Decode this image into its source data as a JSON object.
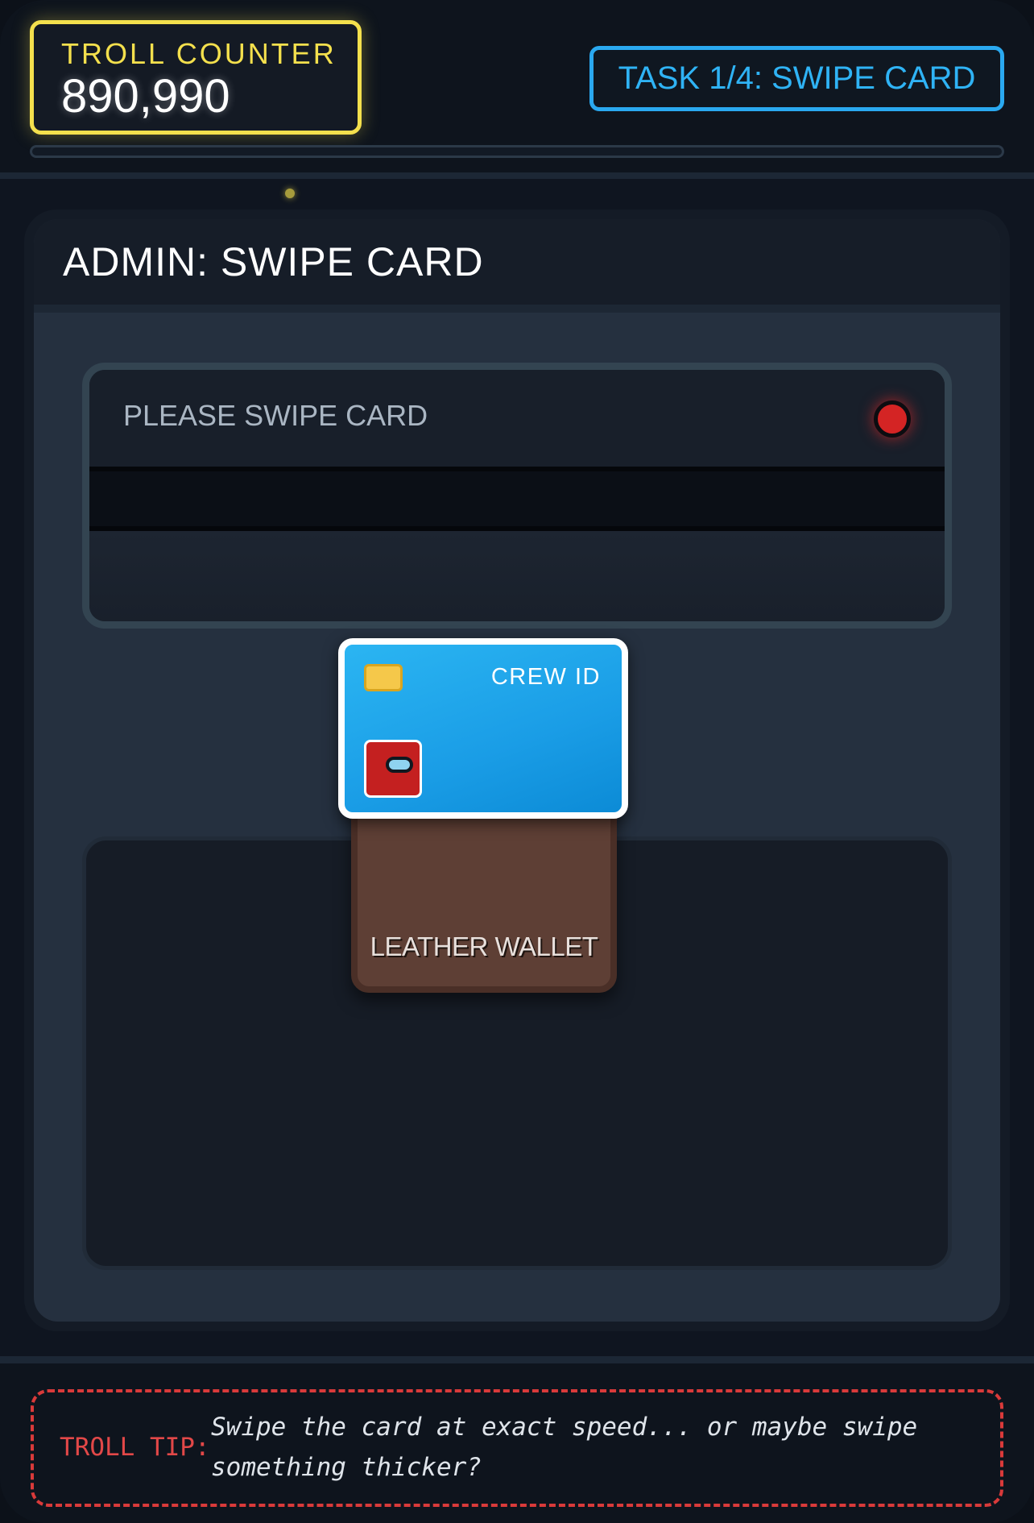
{
  "header": {
    "troll_counter_label": "TROLL COUNTER",
    "troll_counter_value": "890,990",
    "task_badge": "TASK 1/4: SWIPE CARD",
    "progress": 0
  },
  "panel": {
    "title": "ADMIN: SWIPE CARD",
    "reader": {
      "status": "PLEASE SWIPE CARD",
      "led_color": "#d42424"
    },
    "card": {
      "label": "CREW ID",
      "color": "#1a9de6",
      "chip_icon": "card-chip-icon",
      "avatar_icon": "crewmate-icon"
    },
    "wallet": {
      "label": "LEATHER WALLET"
    }
  },
  "footer": {
    "tip_label": "TROLL TIP:",
    "tip_text": "Swipe the card at exact speed... or maybe swipe something thicker?"
  },
  "colors": {
    "accent_yellow": "#f4e04d",
    "accent_blue": "#2aa9f0",
    "alert_red": "#d93a3a"
  }
}
